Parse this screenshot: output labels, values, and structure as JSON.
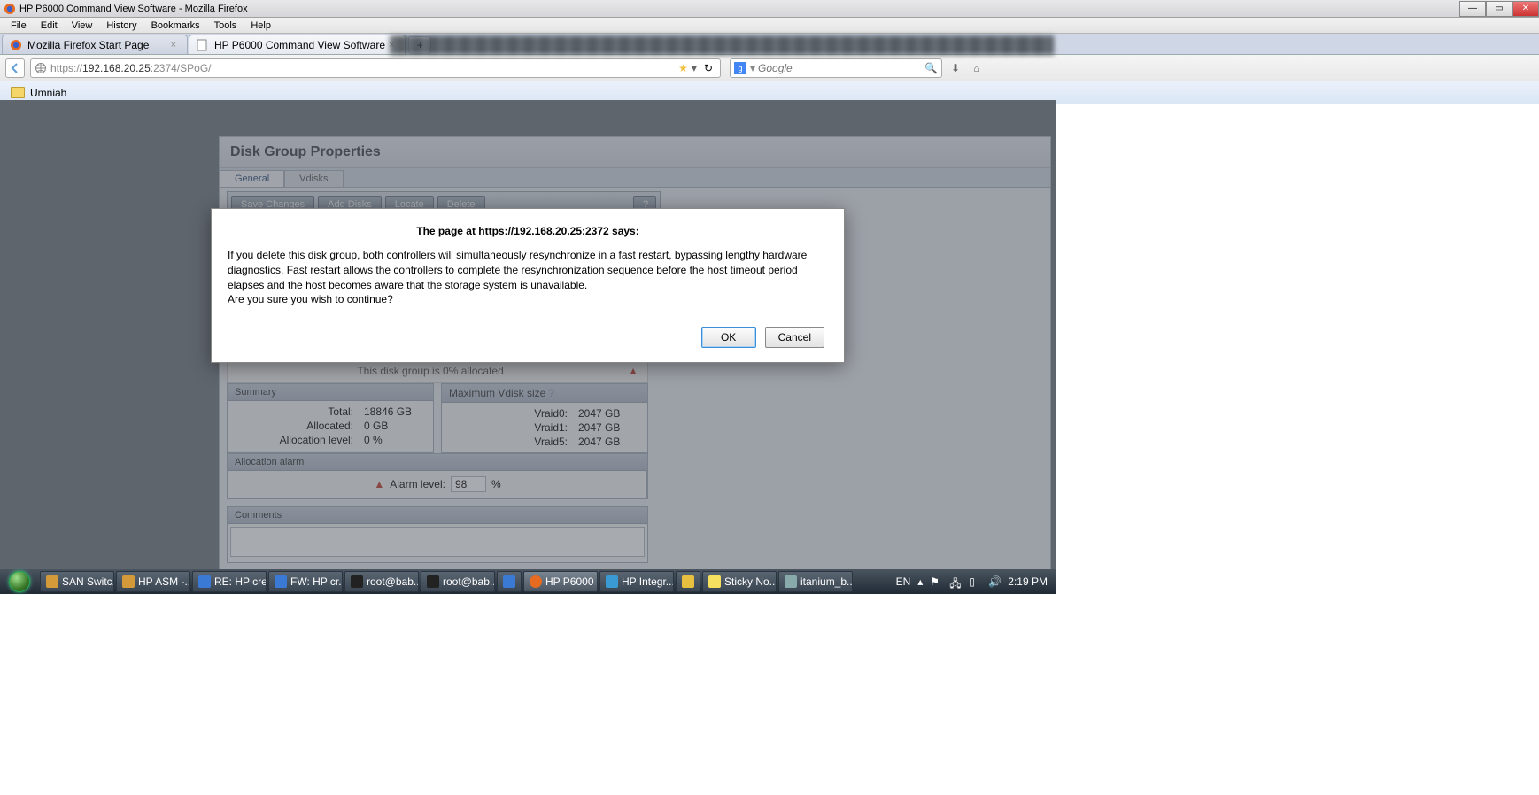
{
  "window": {
    "title": "HP P6000 Command View Software - Mozilla Firefox"
  },
  "menus": [
    "File",
    "Edit",
    "View",
    "History",
    "Bookmarks",
    "Tools",
    "Help"
  ],
  "tabs": [
    {
      "label": "Mozilla Firefox Start Page",
      "active": false
    },
    {
      "label": "HP P6000 Command View Software",
      "active": true
    }
  ],
  "url": {
    "prefix": "https://",
    "host": "192.168.20.25",
    "rest": ":2374/SPoG/"
  },
  "search": {
    "placeholder": "Google"
  },
  "bookmarks": [
    {
      "label": "Umniah"
    }
  ],
  "page": {
    "heading": "Disk Group Properties",
    "tabs": {
      "general": "General",
      "vdisks": "Vdisks"
    },
    "toolbar": {
      "save": "Save Changes",
      "add": "Add Disks",
      "locate": "Locate",
      "delete": "Delete",
      "help": "?"
    },
    "alloc_note": "This disk group is 0% allocated",
    "summary": {
      "title": "Summary",
      "total_label": "Total:",
      "total_val": "18846 GB",
      "alloc_label": "Allocated:",
      "alloc_val": "0 GB",
      "level_label": "Allocation level:",
      "level_val": "0 %"
    },
    "maxv": {
      "title": "Maximum Vdisk size",
      "r0_label": "Vraid0:",
      "r0_val": "2047 GB",
      "r1_label": "Vraid1:",
      "r1_val": "2047 GB",
      "r5_label": "Vraid5:",
      "r5_val": "2047 GB"
    },
    "alarm": {
      "title": "Allocation alarm",
      "label": "Alarm level:",
      "value": "98",
      "unit": "%"
    },
    "comments": {
      "title": "Comments"
    }
  },
  "dialog": {
    "title": "The page at https://192.168.20.25:2372 says:",
    "line1": "If you delete this disk group, both controllers will simultaneously resynchronize in a fast restart, bypassing lengthy hardware diagnostics. Fast restart allows the controllers to complete the resynchronization sequence before the host timeout period elapses and the host becomes aware that the storage system is unavailable.",
    "line2": "Are you sure you wish to continue?",
    "ok": "OK",
    "cancel": "Cancel"
  },
  "taskbar": {
    "items": [
      "SAN Switc...",
      "HP ASM -...",
      "RE: HP cre...",
      "FW: HP cr...",
      "root@bab...",
      "root@bab...",
      "",
      "HP P6000 ...",
      "HP Integr...",
      "",
      "Sticky No...",
      "itanium_b..."
    ],
    "lang": "EN",
    "clock": "2:19 PM"
  }
}
